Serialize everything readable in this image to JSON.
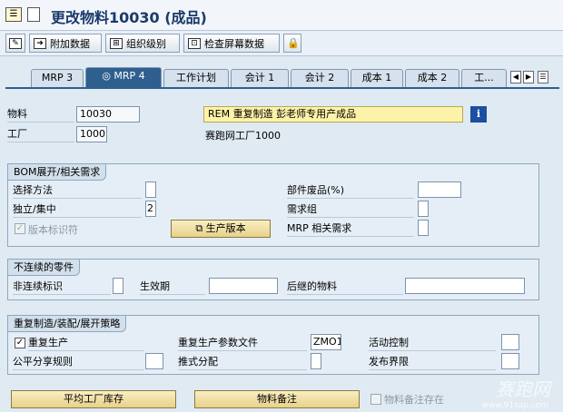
{
  "window": {
    "title": "更改物料10030 (成品)"
  },
  "toolbar": {
    "additional_data": "附加数据",
    "org_levels": "组织级别",
    "check_screen": "检查屏幕数据"
  },
  "tabs": [
    "MRP 3",
    "MRP 4",
    "工作计划",
    "会计 1",
    "会计 2",
    "成本 1",
    "成本 2",
    "工..."
  ],
  "active_tab": "MRP 4",
  "header": {
    "material_label": "物料",
    "material_value": "10030",
    "material_desc": "REM 重复制造 彭老师专用产成品",
    "plant_label": "工厂",
    "plant_value": "1000",
    "plant_desc": "赛跑网工厂1000"
  },
  "bom_group": {
    "title": "BOM展开/相关需求",
    "selection_method": "选择方法",
    "selection_method_value": "",
    "individual_collective": "独立/集中",
    "individual_collective_value": "2",
    "version_indicator": "版本标识符",
    "production_version_button": "生产版本",
    "component_scrap": "部件废品(%)",
    "component_scrap_value": "",
    "requirements_group": "需求组",
    "requirements_group_value": "",
    "mrp_dep_req": "MRP 相关需求",
    "mrp_dep_req_value": ""
  },
  "discontinued_group": {
    "title": "不连续的零件",
    "discontinuation_ind": "非连续标识",
    "effective_date": "生效期",
    "follow_up_material": "后继的物料"
  },
  "repetitive_group": {
    "title": "重复制造/装配/展开策略",
    "repetitive_mfg": "重复生产",
    "rem_profile": "重复生产参数文件",
    "rem_profile_value": "ZMO1",
    "action_control": "活动控制",
    "fair_share_rule": "公平分享规则",
    "push_distribution": "推式分配",
    "deployment_horizon": "发布界限"
  },
  "bottom": {
    "plant_stock_button": "平均工厂库存",
    "material_memo_button": "物料备注",
    "memo_exists": "物料备注存在"
  },
  "watermark": {
    "brand": "赛跑网",
    "url": "www.91sap.com"
  }
}
